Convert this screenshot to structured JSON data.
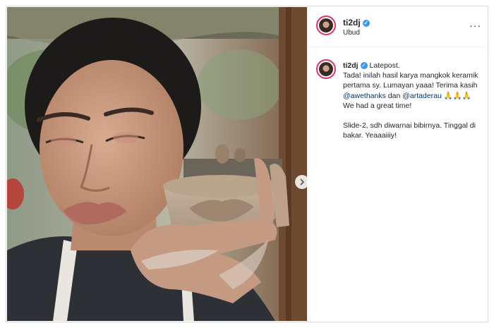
{
  "post": {
    "username": "ti2dj",
    "location": "Ubud",
    "verified_symbol": "✓",
    "more_label": "···",
    "next_icon": "chevron-right-icon"
  },
  "caption": {
    "username": "ti2dj",
    "part1": "Latepost.",
    "part2": "Tada! inilah hasil karya mangkok keramik pertama sy. Lumayan yaaa! Terima kasih",
    "mention1": "@awethanks",
    "part3": "dan",
    "mention2": "@artaderau",
    "emoji": "🙏🙏🙏",
    "part4": "We had a great time!",
    "paragraph2": "Slide-2, sdh diwarnai bibirnya. Tinggal di bakar. Yeaaaiiiy!"
  },
  "colors": {
    "ring": "#e1306c",
    "verified": "#3897f0",
    "mention": "#00376b"
  }
}
